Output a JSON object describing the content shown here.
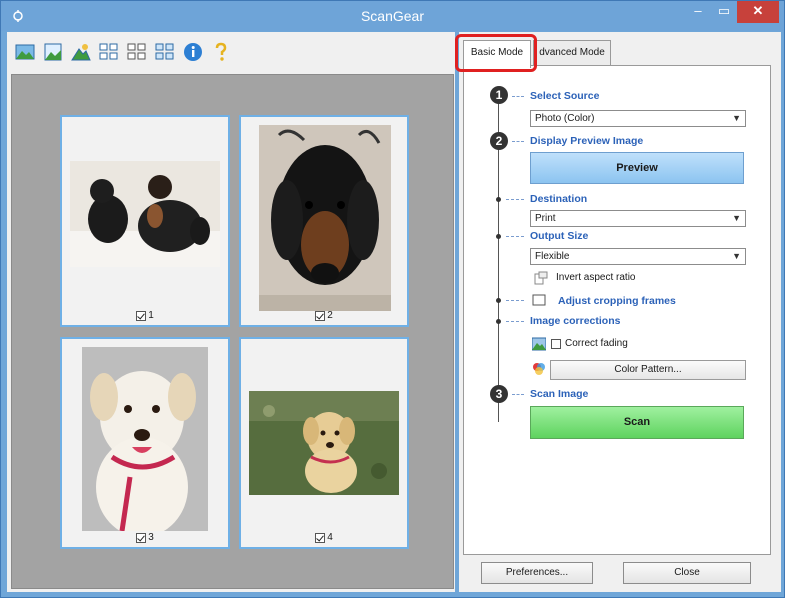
{
  "window": {
    "title": "ScanGear",
    "minimize_glyph": "–",
    "maximize_glyph": "▭",
    "close_glyph": "✕"
  },
  "toolbar": {
    "icons": [
      "crop-photo-icon",
      "crop-document-icon",
      "remove-crop-icon",
      "thumbnail-small-icon",
      "thumbnail-large-icon",
      "thumbnail-multi-icon",
      "info-icon",
      "help-icon"
    ]
  },
  "thumbnails": [
    {
      "label": "1",
      "checked": true
    },
    {
      "label": "2",
      "checked": true
    },
    {
      "label": "3",
      "checked": true
    },
    {
      "label": "4",
      "checked": true
    }
  ],
  "tabs": [
    {
      "label": "Basic Mode",
      "active": true
    },
    {
      "label": "dvanced Mode",
      "active": false
    }
  ],
  "steps": {
    "step1": {
      "number": "1",
      "title": "Select Source",
      "select_value": "Photo (Color)"
    },
    "step2": {
      "number": "2",
      "title": "Display Preview Image",
      "button_label": "Preview"
    },
    "destination": {
      "title": "Destination",
      "select_value": "Print"
    },
    "output_size": {
      "title": "Output Size",
      "select_value": "Flexible",
      "invert_label": "Invert aspect ratio"
    },
    "cropping": {
      "label": "Adjust cropping frames"
    },
    "corrections": {
      "title": "Image corrections",
      "correct_fading_label": "Correct fading",
      "color_pattern_label": "Color Pattern..."
    },
    "step3": {
      "number": "3",
      "title": "Scan Image",
      "button_label": "Scan"
    }
  },
  "footer": {
    "preferences_label": "Preferences...",
    "close_label": "Close"
  },
  "colors": {
    "title_bar": "#6ea4d8",
    "close_button": "#c7413b",
    "section_title": "#2c62b8",
    "preview_button": "#9fd0f5",
    "scan_button": "#6fdc6f",
    "tab_highlight": "#e02020"
  }
}
